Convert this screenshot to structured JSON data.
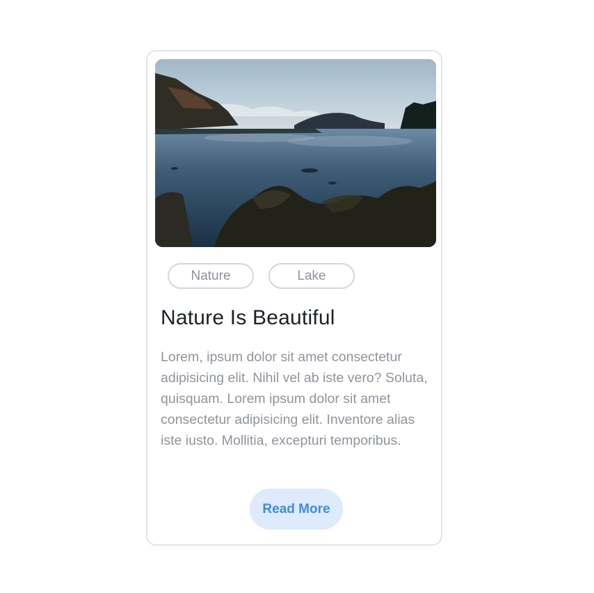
{
  "card": {
    "image": {
      "alt_icon": "landscape-photo"
    },
    "tags": [
      {
        "label": "Nature"
      },
      {
        "label": "Lake"
      }
    ],
    "title": "Nature Is Beautiful",
    "description": "Lorem, ipsum dolor sit amet consectetur adipisicing elit. Nihil vel ab iste vero? Soluta, quisquam. Lorem ipsum dolor sit amet consectetur adipisicing elit. Inventore alias iste iusto. Mollitia, excepturi temporibus.",
    "button_label": "Read More"
  },
  "colors": {
    "accent": "#3b8ce6",
    "button_bg": "#ddebfc",
    "title": "#1b2129",
    "body_text": "#8e949d",
    "border": "#e2e4e8"
  }
}
